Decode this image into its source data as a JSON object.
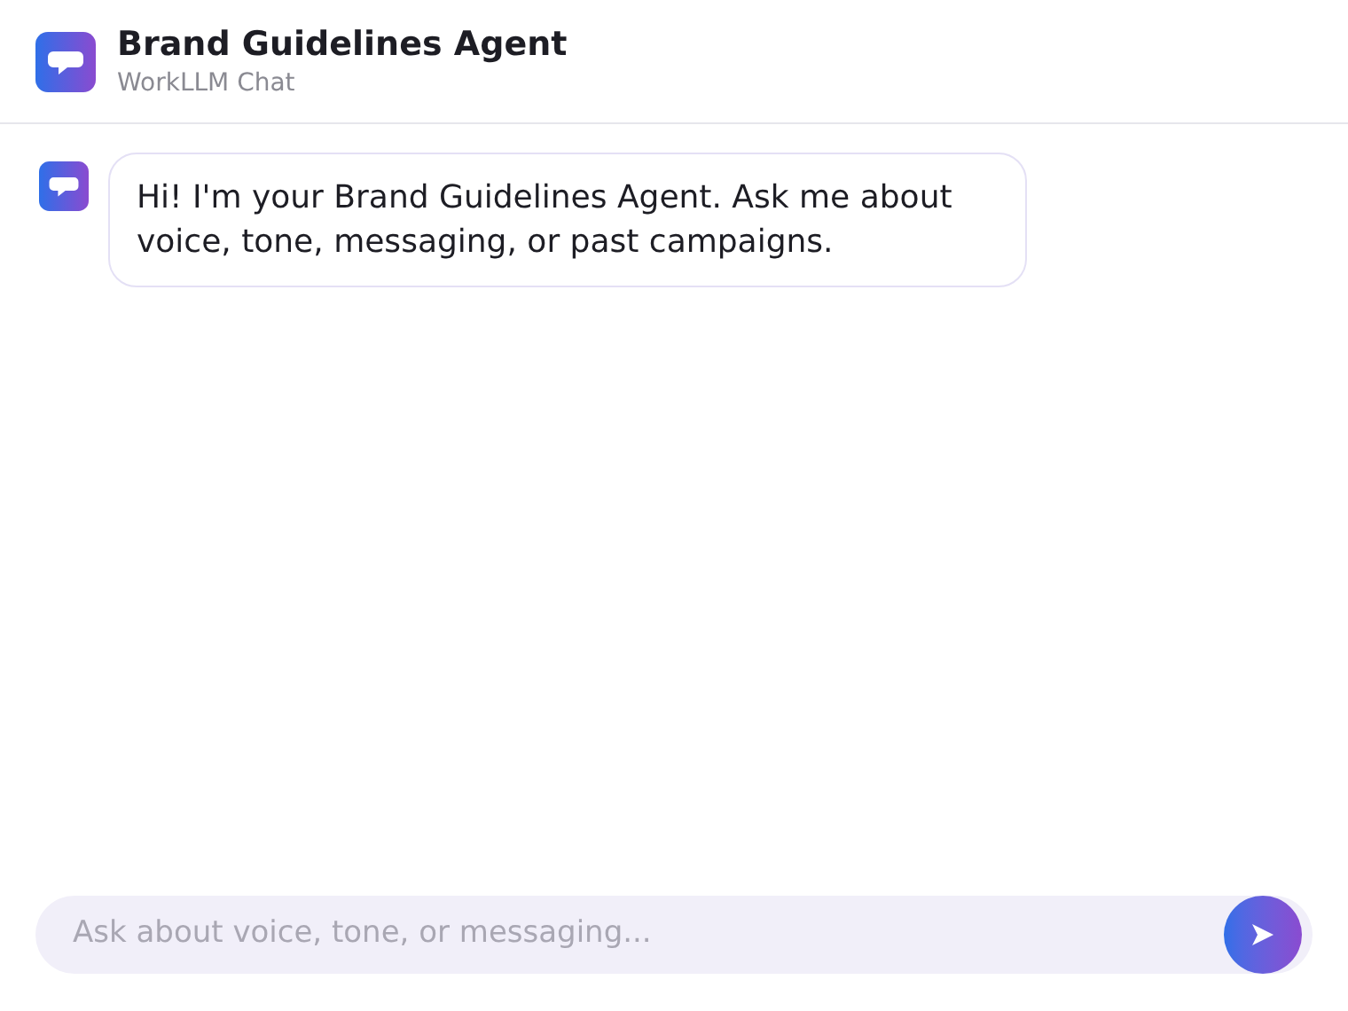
{
  "header": {
    "title": "Brand Guidelines Agent",
    "subtitle": "WorkLLM Chat"
  },
  "messages": [
    {
      "kind": "agent",
      "text": "Hi! I'm your Brand Guidelines Agent. Ask me about voice, tone, messaging, or past campaigns."
    }
  ],
  "composer": {
    "placeholder": "Ask about voice, tone, or messaging..."
  }
}
